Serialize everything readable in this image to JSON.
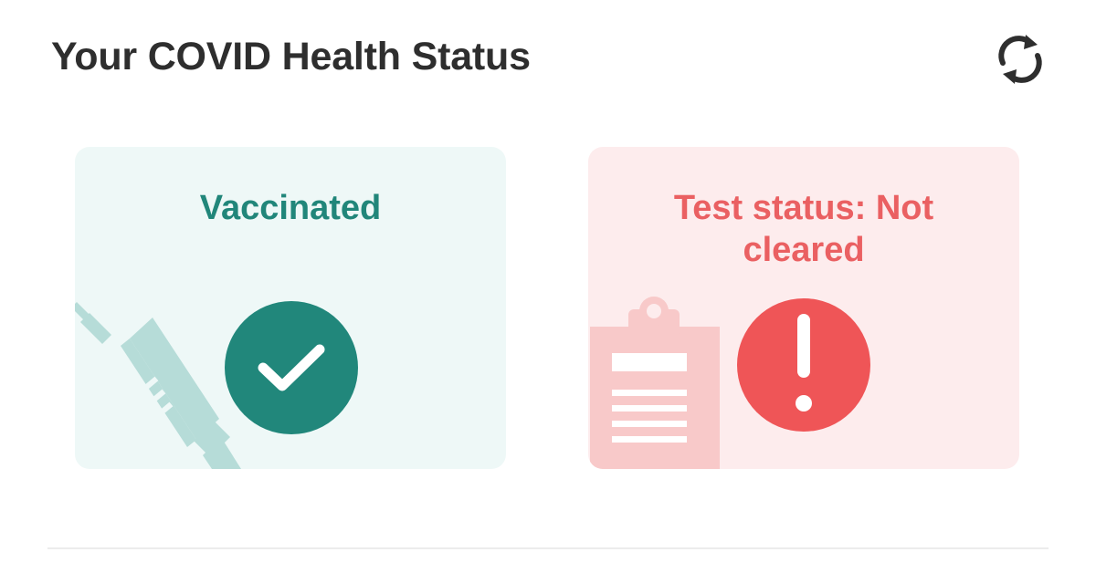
{
  "header": {
    "title": "Your COVID Health Status",
    "refresh_icon": "refresh-icon"
  },
  "cards": [
    {
      "id": "vaccination",
      "label": "Vaccinated",
      "status_icon": "checkmark-icon",
      "illustration": "syringe-icon",
      "text_color": "#21867a",
      "background": "#eef8f7",
      "icon_color": "#21877b"
    },
    {
      "id": "test",
      "label": "Test status: Not cleared",
      "status_icon": "exclamation-icon",
      "illustration": "clipboard-icon",
      "text_color": "#ea6062",
      "background": "#fdeced",
      "icon_color": "#ef5557"
    }
  ]
}
